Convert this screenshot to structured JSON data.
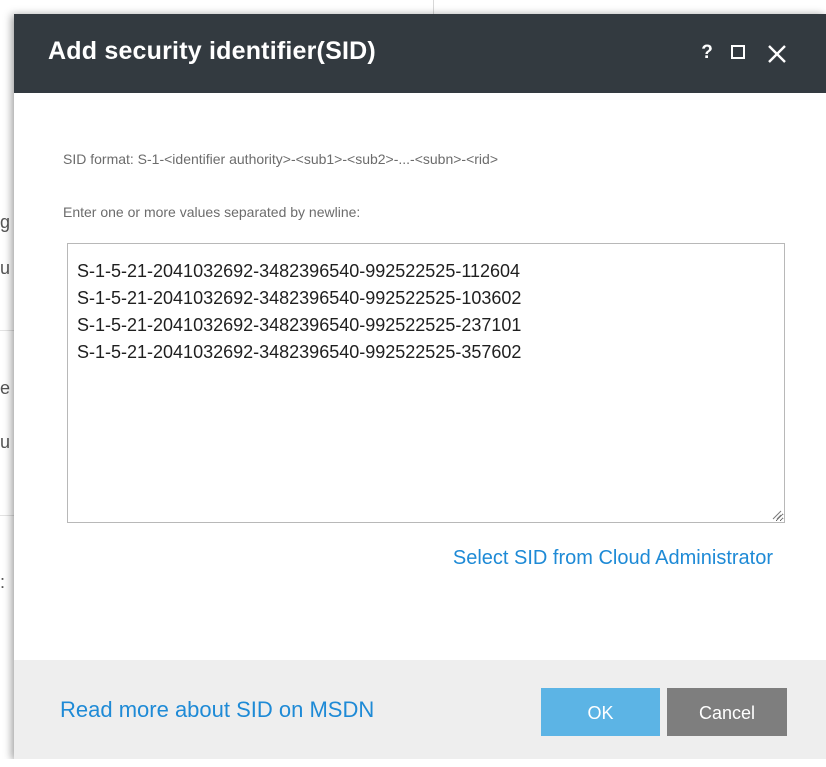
{
  "dialog": {
    "title": "Add security identifier(SID)",
    "controls": {
      "help": "?",
      "maximize_icon": "maximize-icon",
      "close_icon": "close-icon"
    },
    "format_hint": "SID format: S-1-<identifier authority>-<sub1>-<sub2>-...-<subn>-<rid>",
    "input_label": "Enter one or more values separated by newline:",
    "sid_values": "S-1-5-21-2041032692-3482396540-992522525-112604\nS-1-5-21-2041032692-3482396540-992522525-103602\nS-1-5-21-2041032692-3482396540-992522525-237101\nS-1-5-21-2041032692-3482396540-992522525-357602",
    "select_link": "Select SID from Cloud Administrator",
    "footer": {
      "msdn_link": "Read more about SID on MSDN",
      "ok_label": "OK",
      "cancel_label": "Cancel"
    }
  },
  "colors": {
    "titlebar": "#333a40",
    "link": "#1e8ad6",
    "ok_button": "#5cb4e5",
    "cancel_button": "#7e7e7e",
    "footer_bg": "#eeeeee"
  }
}
